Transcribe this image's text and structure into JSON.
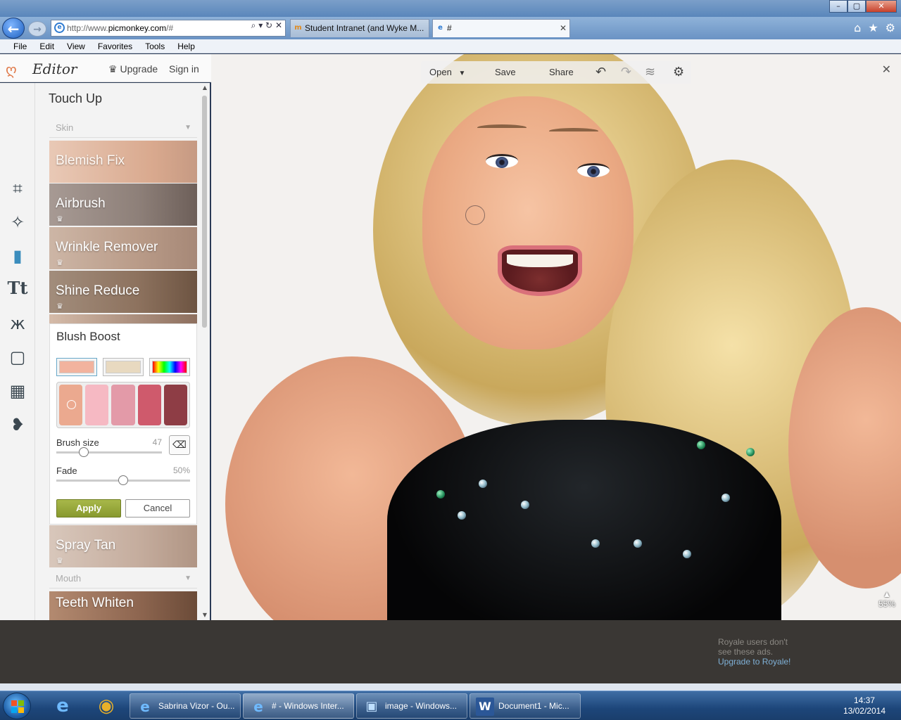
{
  "browser": {
    "window_buttons": {
      "minimize": "–",
      "maximize": "▢",
      "close": "✕"
    },
    "address": "http://www.picmonkey.com/#",
    "address_display_prefix": "http://www.",
    "address_display_domain": "picmonkey.com",
    "address_display_suffix": "/#",
    "tabs": [
      {
        "label": "Student Intranet (and Wyke M...",
        "icon": "moodle-icon"
      },
      {
        "label": "#",
        "icon": "ie-icon"
      }
    ],
    "menu": [
      "File",
      "Edit",
      "View",
      "Favorites",
      "Tools",
      "Help"
    ]
  },
  "editor": {
    "logo_text": "Editor",
    "upgrade": "Upgrade",
    "signin": "Sign in",
    "panel_title": "Touch Up",
    "categories": {
      "skin": "Skin",
      "mouth": "Mouth"
    },
    "effects": [
      "Blemish Fix",
      "Airbrush",
      "Wrinkle Remover",
      "Shine Reduce",
      "Spray Tan",
      "Teeth Whiten"
    ],
    "blush": {
      "title": "Blush Boost",
      "swatch_tabs": [
        "#f2b39e",
        "#e8d9c0",
        "rainbow"
      ],
      "palette": [
        "#eba98f",
        "#f6b9c3",
        "#e39aa8",
        "#cf5a6c",
        "#8e3d45"
      ],
      "brush_label": "Brush size",
      "brush_value": "47",
      "fade_label": "Fade",
      "fade_value": "50%",
      "apply": "Apply",
      "cancel": "Cancel"
    }
  },
  "canvas_toolbar": {
    "open": "Open",
    "save": "Save",
    "share": "Share"
  },
  "zoom": "55%",
  "ad": {
    "line1": "Royale users don't",
    "line2": "see these ads.",
    "link": "Upgrade to Royale!"
  },
  "taskbar": {
    "tasks": [
      {
        "label": "Sabrina Vizor - Ou..."
      },
      {
        "label": "# - Windows Inter..."
      },
      {
        "label": "image - Windows..."
      },
      {
        "label": "Document1 - Mic..."
      }
    ],
    "time": "14:37",
    "date": "13/02/2014"
  }
}
